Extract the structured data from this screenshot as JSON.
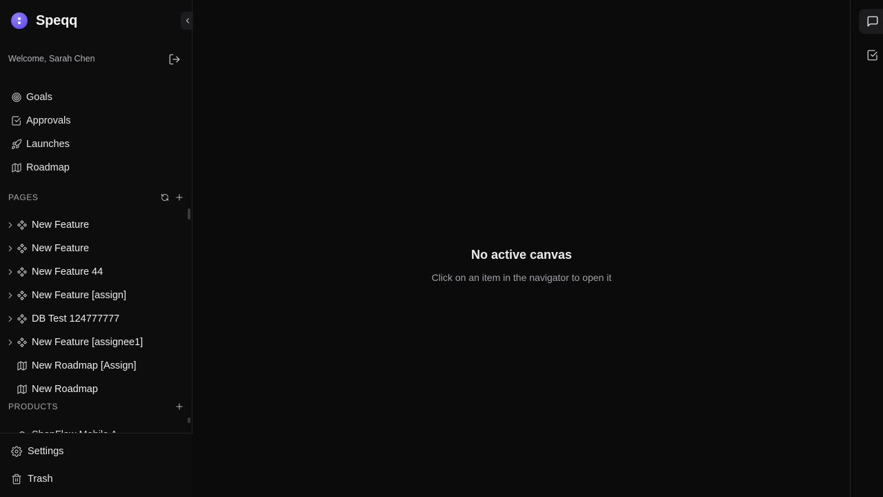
{
  "brand": {
    "name": "Speqq"
  },
  "user": {
    "welcome": "Welcome, Sarah Chen"
  },
  "nav": {
    "items": [
      {
        "label": "Goals",
        "icon": "target-icon"
      },
      {
        "label": "Approvals",
        "icon": "check-square-icon"
      },
      {
        "label": "Launches",
        "icon": "rocket-icon"
      },
      {
        "label": "Roadmap",
        "icon": "map-icon"
      }
    ]
  },
  "pages": {
    "title": "PAGES",
    "items": [
      {
        "label": "New Feature",
        "icon": "component-icon",
        "expandable": true
      },
      {
        "label": "New Feature",
        "icon": "component-icon",
        "expandable": true
      },
      {
        "label": "New Feature 44",
        "icon": "component-icon",
        "expandable": true
      },
      {
        "label": "New Feature [assign]",
        "icon": "component-icon",
        "expandable": true
      },
      {
        "label": "DB Test 124777777",
        "icon": "component-icon",
        "expandable": true
      },
      {
        "label": "New Feature [assignee1]",
        "icon": "component-icon",
        "expandable": true
      },
      {
        "label": "New Roadmap [Assign]",
        "icon": "map-icon",
        "expandable": false
      },
      {
        "label": "New Roadmap",
        "icon": "map-icon",
        "expandable": false
      }
    ]
  },
  "products": {
    "title": "PRODUCTS",
    "partial_item": "ShopFlow Mobile A"
  },
  "bottom": {
    "settings": "Settings",
    "trash": "Trash"
  },
  "main": {
    "empty_title": "No active canvas",
    "empty_subtitle": "Click on an item in the navigator to open it"
  },
  "colors": {
    "accent": "#6b55f0",
    "background": "#0b0b0c",
    "sidebar": "#0d0d0e"
  }
}
